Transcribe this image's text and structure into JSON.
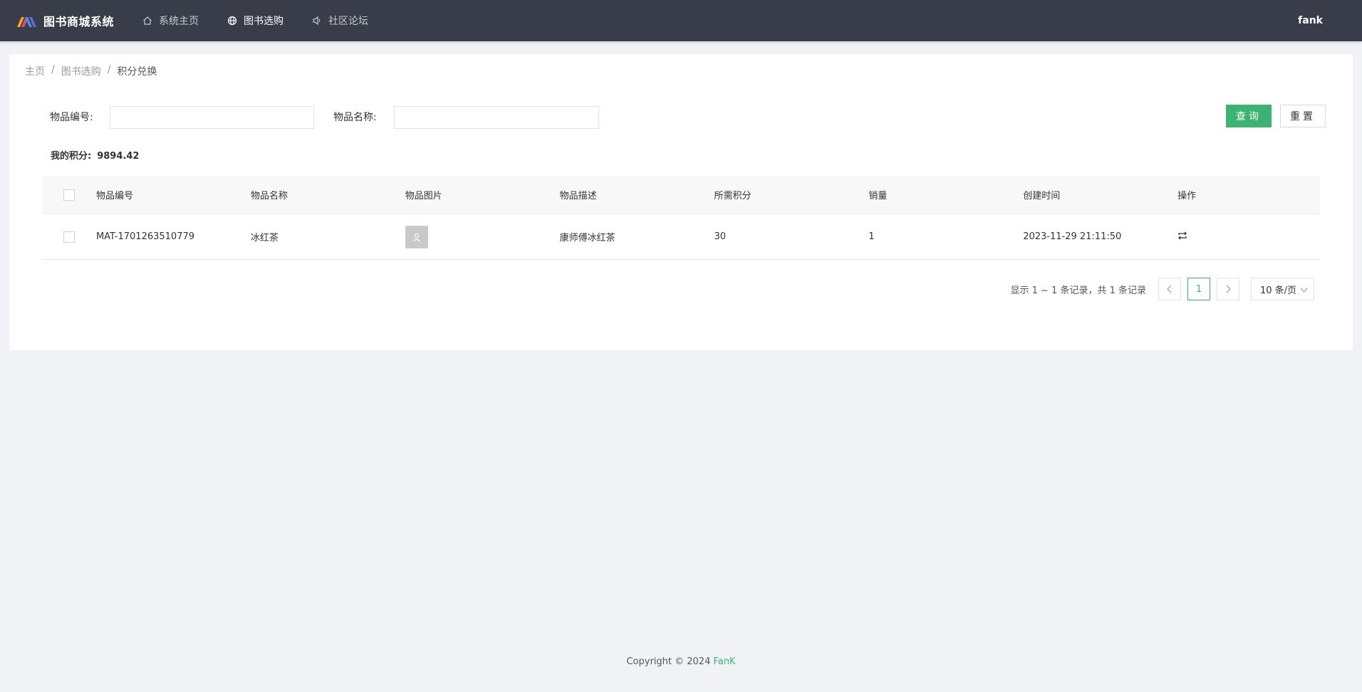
{
  "app": {
    "title": "图书商城系统",
    "user": "fank"
  },
  "nav": [
    {
      "label": "系统主页",
      "icon": "home-icon"
    },
    {
      "label": "图书选购",
      "icon": "globe-icon"
    },
    {
      "label": "社区论坛",
      "icon": "speaker-icon"
    }
  ],
  "breadcrumb": {
    "home": "主页",
    "section": "图书选购",
    "current": "积分兑换",
    "separator": "/"
  },
  "search": {
    "code_label": "物品编号:",
    "code_value": "",
    "name_label": "物品名称:",
    "name_value": "",
    "query_label": "查询",
    "reset_label": "重置"
  },
  "points": {
    "label": "我的积分:",
    "value": "9894.42"
  },
  "table": {
    "headers": [
      "物品编号",
      "物品名称",
      "物品图片",
      "物品描述",
      "所需积分",
      "销量",
      "创建时间",
      "操作"
    ],
    "rows": [
      {
        "code": "MAT-1701263510779",
        "name": "冰红茶",
        "image": "user-placeholder-icon",
        "description": "康师傅冰红茶",
        "points": "30",
        "sales": "1",
        "created": "2023-11-29 21:11:50",
        "action": "exchange-icon"
      }
    ]
  },
  "pager": {
    "info": "显示 1 ~ 1 条记录，共 1 条记录",
    "current_page": "1",
    "page_size": "10 条/页"
  },
  "footer": {
    "copyright": "Copyright © 2024",
    "brand": "FanK"
  },
  "colors": {
    "topbar": "#393d49",
    "accent": "#3cb371",
    "background": "#f0f2f5"
  }
}
